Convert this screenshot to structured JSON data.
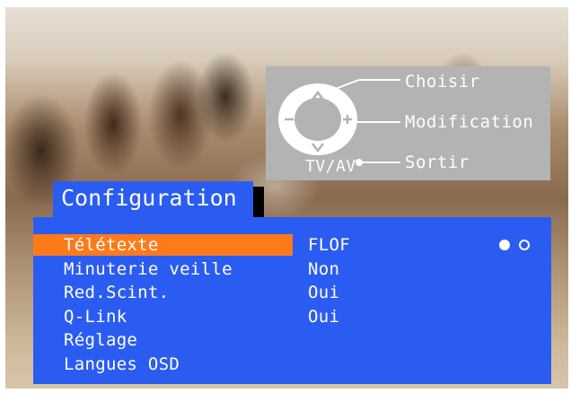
{
  "help": {
    "select_label": "Choisir",
    "modify_label": "Modification",
    "exit_label": "Sortir",
    "exit_key_label": "TV/AV"
  },
  "menu": {
    "title": "Configuration",
    "items": [
      {
        "label": "Télétexte",
        "value": "FLOF",
        "selected": true
      },
      {
        "label": "Minuterie veille",
        "value": "Non",
        "selected": false
      },
      {
        "label": "Red.Scint.",
        "value": "Oui",
        "selected": false
      },
      {
        "label": "Q-Link",
        "value": "Oui",
        "selected": false
      },
      {
        "label": "Réglage",
        "value": "",
        "selected": false
      },
      {
        "label": "Langues OSD",
        "value": "",
        "selected": false
      }
    ],
    "option_indicator": {
      "count": 2,
      "active_index": 0
    }
  },
  "colors": {
    "panel": "#2b5cf2",
    "highlight": "#ff7a1a",
    "help_box": "#b3b3b3",
    "text": "#ffffff"
  }
}
